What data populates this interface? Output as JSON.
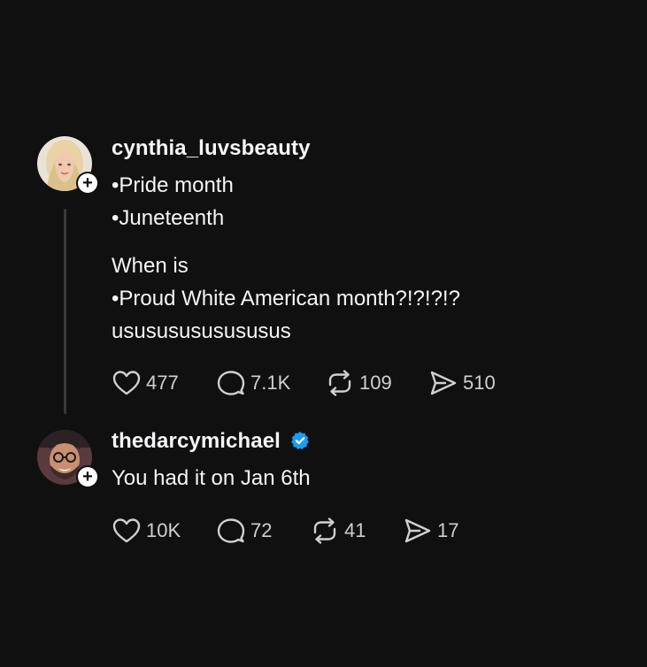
{
  "posts": [
    {
      "username": "cynthia_luvsbeauty",
      "verified": false,
      "lines": [
        "•Pride month",
        "•Juneteenth",
        "When is",
        "•Proud White American month?!?!?!?",
        "usususususususus"
      ],
      "stats": {
        "likes": "477",
        "replies": "7.1K",
        "reposts": "109",
        "shares": "510"
      }
    },
    {
      "username": "thedarcymichael",
      "verified": true,
      "lines": [
        "You had it on Jan 6th"
      ],
      "stats": {
        "likes": "10K",
        "replies": "72",
        "reposts": "41",
        "shares": "17"
      }
    }
  ],
  "icons": {
    "like": "heart-icon",
    "reply": "comment-icon",
    "repost": "repost-icon",
    "share": "send-icon",
    "follow": "plus-icon",
    "verified": "verified-badge-icon"
  },
  "colors": {
    "background": "#101010",
    "text": "#f3f5f7",
    "verified": "#1d9bf0"
  }
}
